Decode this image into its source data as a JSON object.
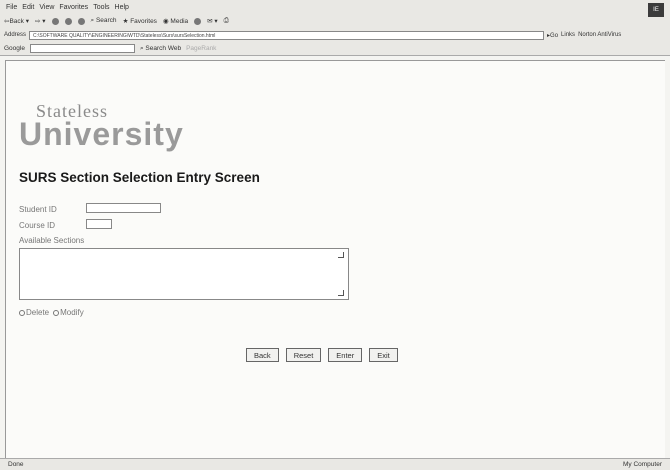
{
  "browser": {
    "menu": [
      "File",
      "Edit",
      "View",
      "Favorites",
      "Tools",
      "Help"
    ],
    "toolbar": {
      "back": "Back",
      "search": "Search",
      "favorites": "Favorites",
      "media": "Media"
    },
    "address": {
      "label": "Address",
      "value": "C:\\SOFTWARE QUALITY\\ENGINEERING\\WTD\\Stateless\\Surs\\sursSelection.html",
      "go": "Go",
      "links": "Links",
      "norton": "Norton AntiVirus"
    },
    "google": {
      "label": "Google",
      "search_web": "Search Web",
      "pagerank": "PageRank"
    },
    "status_left": "Done",
    "status_right": "My Computer"
  },
  "page": {
    "logo_top": "Stateless",
    "logo_bottom": "University",
    "title": "SURS Section Selection Entry Screen",
    "student_id_label": "Student ID",
    "course_id_label": "Course ID",
    "available_sections_label": "Available Sections",
    "radio_delete": "Delete",
    "radio_modify": "Modify",
    "buttons": {
      "back": "Back",
      "reset": "Reset",
      "enter": "Enter",
      "exit": "Exit"
    }
  }
}
